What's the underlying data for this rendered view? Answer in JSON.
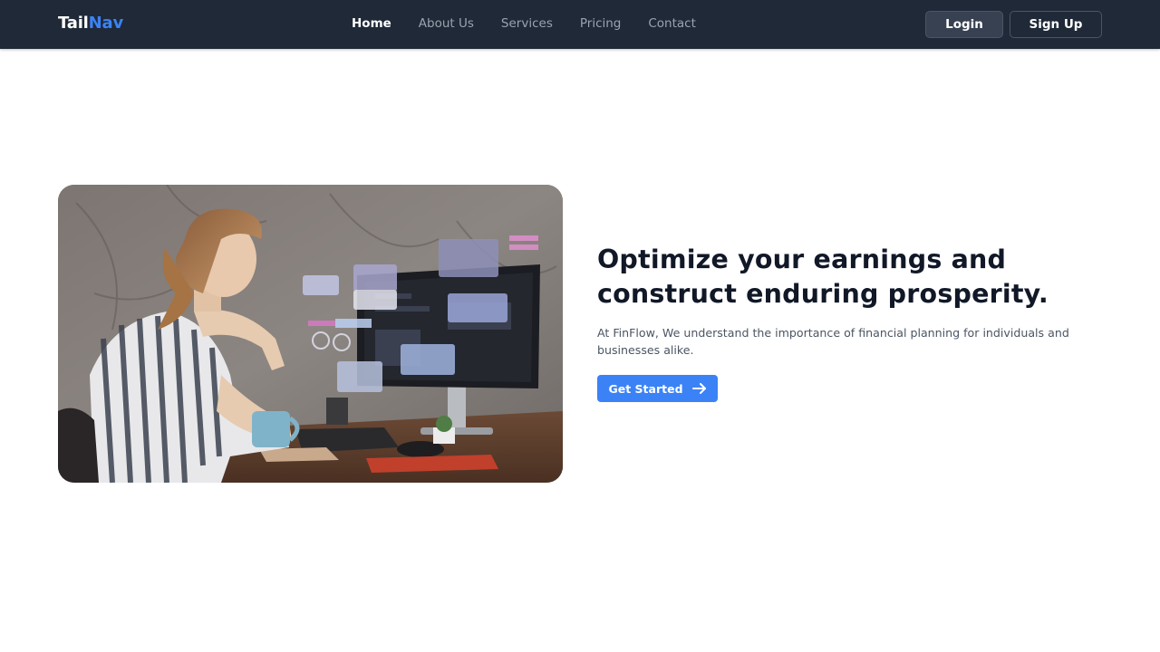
{
  "brand": {
    "prefix": "Tail",
    "suffix": "Nav"
  },
  "nav": {
    "links": [
      {
        "label": "Home",
        "active": true
      },
      {
        "label": "About Us",
        "active": false
      },
      {
        "label": "Services",
        "active": false
      },
      {
        "label": "Pricing",
        "active": false
      },
      {
        "label": "Contact",
        "active": false
      }
    ],
    "login_label": "Login",
    "signup_label": "Sign Up"
  },
  "hero": {
    "title": "Optimize your earnings and construct enduring prosperity.",
    "description": "At FinFlow, We understand the importance of financial planning for individuals and businesses alike.",
    "cta_label": "Get Started",
    "cta_icon": "arrow-right-icon",
    "image_subject": "woman-at-desk-with-holographic-dashboard"
  },
  "colors": {
    "nav_bg": "#1f2937",
    "accent": "#3b82f6",
    "heading": "#111827",
    "body_text": "#4b5563"
  }
}
